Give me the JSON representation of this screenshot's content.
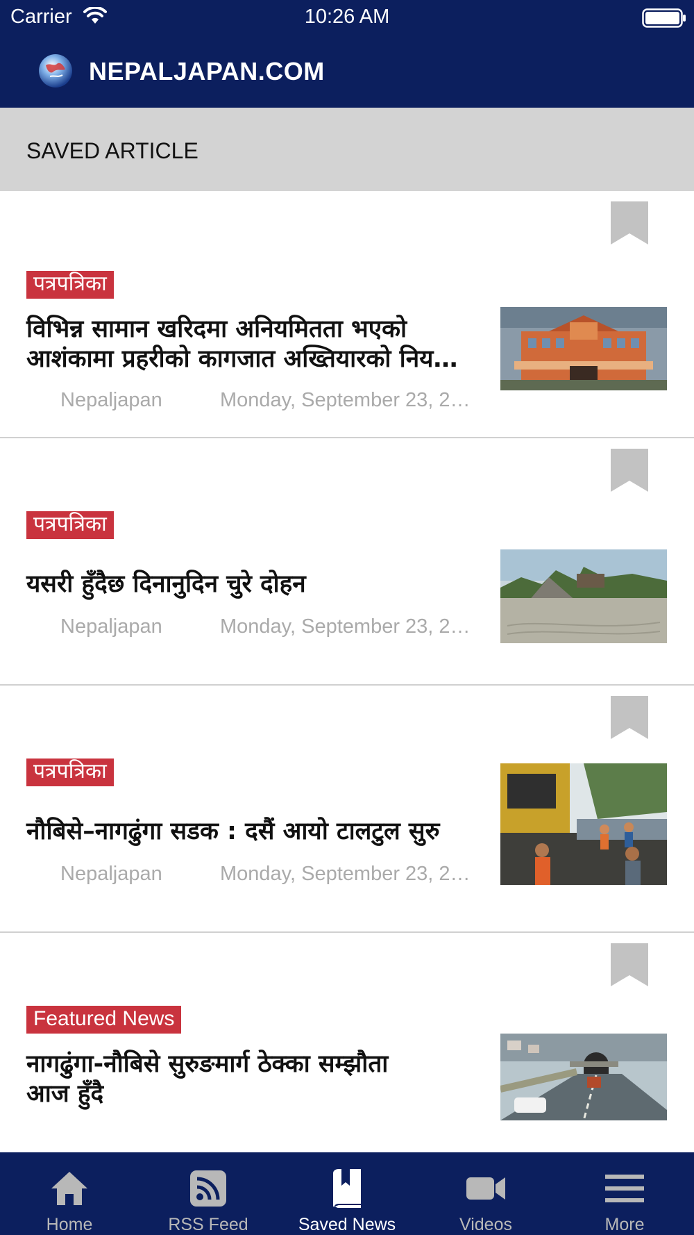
{
  "status_bar": {
    "carrier": "Carrier",
    "time": "10:26 AM",
    "wifi_icon": "wifi-icon",
    "battery_icon": "battery-icon"
  },
  "header": {
    "title": "NEPALJAPAN.COM",
    "logo_icon": "globe-icon",
    "background": "#0c1f5e"
  },
  "section": {
    "title": "SAVED ARTICLE"
  },
  "articles": [
    {
      "category": "पत्रपत्रिका",
      "headline_line1": "विभिन्न सामान खरिदमा अनियमितता भएको",
      "headline_line2": "आशंकामा प्रहरीको कागजात अख्तियारको निय…",
      "source": "Nepaljapan",
      "date": "Monday, September 23, 2…"
    },
    {
      "category": "पत्रपत्रिका",
      "headline_line1": "यसरी हुँदैछ दिनानुदिन चुरे दोहन",
      "headline_line2": "",
      "source": "Nepaljapan",
      "date": "Monday, September 23, 2…"
    },
    {
      "category": "पत्रपत्रिका",
      "headline_line1": "नौबिसे–नागढुंगा सडक : दसैं आयो टालटुल सुरु",
      "headline_line2": "",
      "source": "Nepaljapan",
      "date": "Monday, September 23, 2…"
    },
    {
      "category": "Featured News",
      "headline_line1": "नागढुंगा-नौबिसे सुरुङमार्ग ठेक्का सम्झौता",
      "headline_line2": "आज हुँदै",
      "source": "",
      "date": ""
    }
  ],
  "tab_bar": {
    "tabs": [
      {
        "label": "Home",
        "icon": "home-icon",
        "active": false
      },
      {
        "label": "RSS Feed",
        "icon": "rss-icon",
        "active": false
      },
      {
        "label": "Saved News",
        "icon": "book-icon",
        "active": true
      },
      {
        "label": "Videos",
        "icon": "video-camera-icon",
        "active": false
      },
      {
        "label": "More",
        "icon": "menu-icon",
        "active": false
      }
    ]
  },
  "colors": {
    "brand_navy": "#0c1f5e",
    "category_red": "#c9333e",
    "section_gray": "#d3d3d3",
    "bookmark_gray": "#c2c2c2"
  }
}
